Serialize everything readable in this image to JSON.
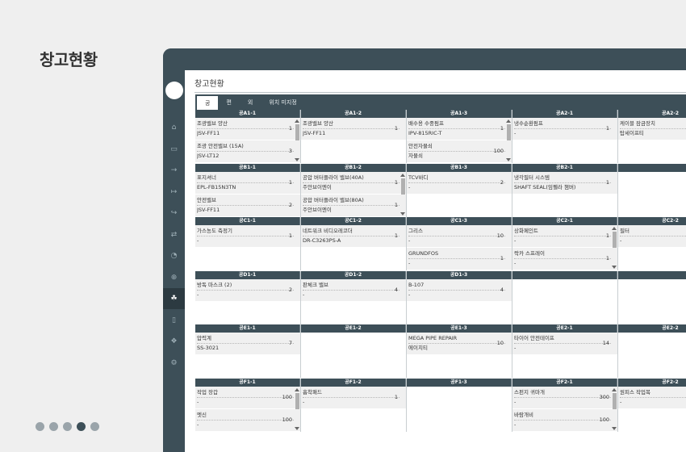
{
  "page_heading": "창고현황",
  "slide_dots": [
    false,
    false,
    false,
    true,
    false
  ],
  "app": {
    "title": "창고현황",
    "tabs": [
      {
        "label": "공",
        "active": true
      },
      {
        "label": "편",
        "active": false
      },
      {
        "label": "외",
        "active": false
      },
      {
        "label": "위치 미지정",
        "active": false
      }
    ],
    "sidebar_icons": [
      "home-icon",
      "inbox-icon",
      "sign-in-icon",
      "sign-out-icon",
      "sign-out-alt-icon",
      "exchange-icon",
      "chart-pie-icon",
      "search-plus-icon",
      "cubes-icon",
      "file-icon",
      "dropbox-icon",
      "gear-icon"
    ],
    "sidebar_active_index": 8,
    "rows": [
      {
        "cols": [
          {
            "head": "공A1-1",
            "scroll": true,
            "items": [
              {
                "name": "조광밸브 양산",
                "model": "JSV-FF11",
                "qty": "1"
              },
              {
                "name": "조광 안전밸브 (15A)",
                "model": "JSV-LT12",
                "qty": "3"
              }
            ]
          },
          {
            "head": "공A1-2",
            "scroll": false,
            "items": [
              {
                "name": "조광밸브 양산",
                "model": "JSV-FF11",
                "qty": "1"
              }
            ]
          },
          {
            "head": "공A1-3",
            "scroll": true,
            "items": [
              {
                "name": "배수용 수중펌프",
                "model": "IPV-815RIC-T",
                "qty": "1"
              },
              {
                "name": "안전자물쇠",
                "model": "자물쇠",
                "qty": "100"
              }
            ]
          },
          {
            "head": "공A2-1",
            "scroll": false,
            "items": [
              {
                "name": "냉수순환펌프",
                "model": "-",
                "qty": "1"
              }
            ]
          },
          {
            "head": "공A2-2",
            "scroll": false,
            "items": [
              {
                "name": "케이블 잠금장치",
                "model": "탑세이프티",
                "qty": ""
              }
            ]
          }
        ]
      },
      {
        "cols": [
          {
            "head": "공B1-1",
            "scroll": false,
            "items": [
              {
                "name": "표지셔너",
                "model": "EPL-FB15N3TN",
                "qty": "1"
              },
              {
                "name": "안전밸브",
                "model": "JSV-FF11",
                "qty": "2"
              }
            ]
          },
          {
            "head": "공B1-2",
            "scroll": true,
            "items": [
              {
                "name": "공압 버터플라이 밸브(40A)",
                "model": "주안브이엔이",
                "qty": "1"
              },
              {
                "name": "공압 버터플라이 밸브(80A)",
                "model": "주안브이엔이",
                "qty": "1"
              }
            ]
          },
          {
            "head": "공B1-3",
            "scroll": false,
            "items": [
              {
                "name": "TCV바디",
                "model": "-",
                "qty": "2"
              }
            ]
          },
          {
            "head": "공B2-1",
            "scroll": false,
            "items": [
              {
                "name": "냉각필터 시스템",
                "model": "SHAFT SEAL(임펠라 챔버)",
                "qty": "1"
              }
            ]
          },
          {
            "head": "",
            "scroll": false,
            "items": []
          }
        ]
      },
      {
        "cols": [
          {
            "head": "공C1-1",
            "scroll": false,
            "items": [
              {
                "name": "가스농도 측정기",
                "model": "-",
                "qty": "1"
              }
            ]
          },
          {
            "head": "공C1-2",
            "scroll": false,
            "items": [
              {
                "name": "네트워크 비디오레코더",
                "model": "DR-C3263PS-A",
                "qty": "1"
              }
            ]
          },
          {
            "head": "공C1-3",
            "scroll": false,
            "items": [
              {
                "name": "그리스",
                "model": "-",
                "qty": "10"
              },
              {
                "name": "GRUNDFOS",
                "model": "-",
                "qty": "1"
              }
            ]
          },
          {
            "head": "공C2-1",
            "scroll": true,
            "items": [
              {
                "name": "상화페인트",
                "model": "-",
                "qty": "1"
              },
              {
                "name": "락카 스프레이",
                "model": "-",
                "qty": "1"
              }
            ]
          },
          {
            "head": "공C2-2",
            "scroll": false,
            "items": [
              {
                "name": "필터",
                "model": "-",
                "qty": ""
              }
            ]
          }
        ]
      },
      {
        "cols": [
          {
            "head": "공D1-1",
            "scroll": false,
            "items": [
              {
                "name": "방독 마스크 (2)",
                "model": "-",
                "qty": "2"
              }
            ]
          },
          {
            "head": "공D1-2",
            "scroll": false,
            "items": [
              {
                "name": "판체크 밸브",
                "model": "-",
                "qty": "4"
              }
            ]
          },
          {
            "head": "공D1-3",
            "scroll": false,
            "items": [
              {
                "name": "B-107",
                "model": "-",
                "qty": "4"
              }
            ]
          },
          {
            "head": "",
            "scroll": false,
            "items": []
          },
          {
            "head": "",
            "scroll": false,
            "items": []
          }
        ]
      },
      {
        "cols": [
          {
            "head": "공E1-1",
            "scroll": false,
            "items": [
              {
                "name": "압력계",
                "model": "SS-3021",
                "qty": "7"
              }
            ]
          },
          {
            "head": "공E1-2",
            "scroll": false,
            "items": []
          },
          {
            "head": "공E1-3",
            "scroll": false,
            "items": [
              {
                "name": "MEGA PIPE REPAIR",
                "model": "에이치티",
                "qty": "10"
              }
            ]
          },
          {
            "head": "공E2-1",
            "scroll": false,
            "items": [
              {
                "name": "타이어 안전테이프",
                "model": "-",
                "qty": "14"
              }
            ]
          },
          {
            "head": "공E2-2",
            "scroll": false,
            "items": []
          }
        ]
      },
      {
        "cols": [
          {
            "head": "공F1-1",
            "scroll": true,
            "items": [
              {
                "name": "작업 장갑",
                "model": "-",
                "qty": "100"
              },
              {
                "name": "멧신",
                "model": "-",
                "qty": "100"
              }
            ]
          },
          {
            "head": "공F1-2",
            "scroll": false,
            "items": [
              {
                "name": "흡착패드",
                "model": "-",
                "qty": "1"
              }
            ]
          },
          {
            "head": "공F1-3",
            "scroll": false,
            "items": []
          },
          {
            "head": "공F2-1",
            "scroll": true,
            "items": [
              {
                "name": "스펀지 귀마개",
                "model": "-",
                "qty": "300"
              },
              {
                "name": "바람개비",
                "model": "-",
                "qty": "100"
              }
            ]
          },
          {
            "head": "공F2-2",
            "scroll": false,
            "items": [
              {
                "name": "원피스 작업복",
                "model": "-",
                "qty": ""
              }
            ]
          }
        ]
      }
    ]
  }
}
